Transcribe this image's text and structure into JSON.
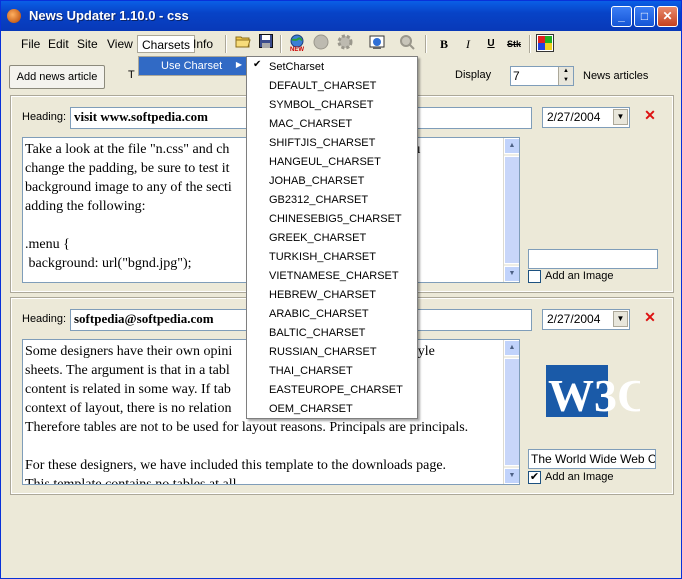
{
  "window": {
    "title": "News Updater 1.10.0 - css",
    "minimize": "_",
    "maximize": "□",
    "close": "✕"
  },
  "menu": {
    "file": "File",
    "edit": "Edit",
    "site": "Site",
    "view": "View",
    "charsets": "Charsets",
    "info": "Info"
  },
  "toolbar": {
    "bold": "B",
    "italic": "I",
    "underline": "U",
    "strike": "Stk"
  },
  "controls": {
    "add_news_label": "Add news article",
    "t_label": "T",
    "display_label": "Display",
    "display_value": "7",
    "news_articles_label": "News articles"
  },
  "submenu": {
    "label": "Use Charset",
    "arrow": "▶"
  },
  "charset_menu": {
    "check": "✔",
    "items": [
      "SetCharset",
      "DEFAULT_CHARSET",
      "SYMBOL_CHARSET",
      "MAC_CHARSET",
      "SHIFTJIS_CHARSET",
      "HANGEUL_CHARSET",
      "JOHAB_CHARSET",
      "GB2312_CHARSET",
      "CHINESEBIG5_CHARSET",
      "GREEK_CHARSET",
      "TURKISH_CHARSET",
      "VIETNAMESE_CHARSET",
      "HEBREW_CHARSET",
      "ARABIC_CHARSET",
      "BALTIC_CHARSET",
      "RUSSIAN_CHARSET",
      "THAI_CHARSET",
      "EASTEUROPE_CHARSET",
      "OEM_CHARSET"
    ]
  },
  "articles": [
    {
      "heading_label": "Heading:",
      "heading": "visit www.softpedia.com",
      "date": "2/27/2004",
      "body": "Take a look at the file \"n.css\" and ch                                   r site. If you\nchange the padding, be sure to test it                                 u can add a\nbackground image to any of the secti                                   ection, by\nadding the following:\n\n.menu {\n background: url(\"bgnd.jpg\");",
      "image_caption": "",
      "add_image_label": "Add an Image",
      "add_image_checked": false
    },
    {
      "heading_label": "Heading:",
      "heading": "softpedia@softpedia.com",
      "date": "2/27/2004",
      "body": "Some designers have their own opini                                     t versus style\nsheets. The argument is that in a tabl                                  y that the\ncontent is related in some way. If tab                                  ntent in the\ncontext of layout, there is no relation                                ever.\nTherefore tables are not to be used for layout reasons. Principals are principals.\n\nFor these designers, we have included this template to the downloads page.\nThis template contains no tables at all.",
      "image_caption": "The World Wide Web Co",
      "logo_text": "W3C",
      "add_image_label": "Add an Image",
      "add_image_checked": true
    }
  ]
}
